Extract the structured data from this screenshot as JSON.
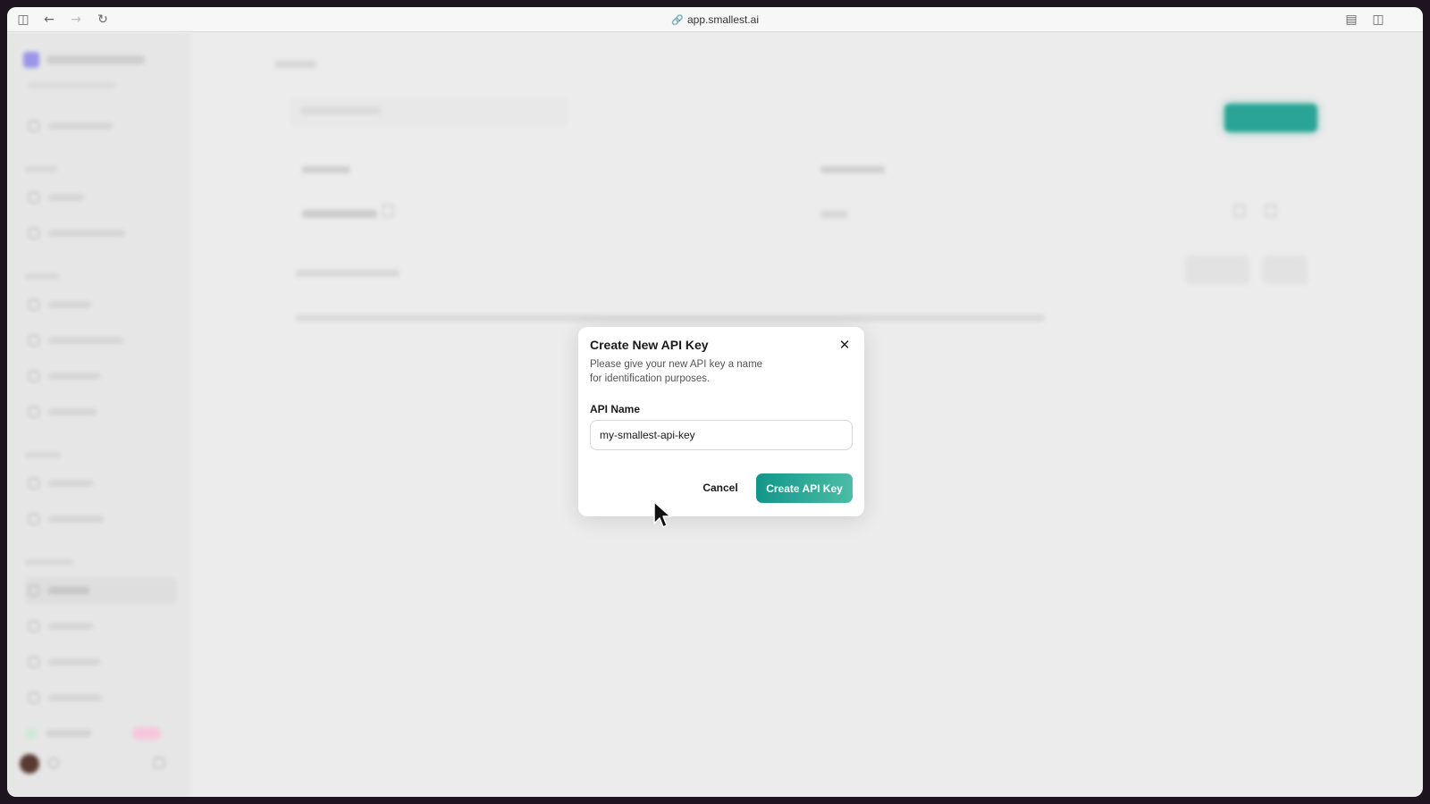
{
  "browser": {
    "url": "app.smallest.ai"
  },
  "modal": {
    "title": "Create New API Key",
    "description": "Please give your new API key a name for identification purposes.",
    "field_label": "API Name",
    "field_value": "my-smallest-api-key",
    "cancel_label": "Cancel",
    "create_label": "Create API Key"
  },
  "icons": {
    "sidebar_toggle": "sidebar-icon",
    "back": "arrow-left-icon",
    "forward": "arrow-right-icon",
    "reload": "reload-icon",
    "link": "link-icon",
    "reader": "reader-icon",
    "split_view": "split-view-icon",
    "close": "close-icon",
    "cursor": "mouse-pointer-icon"
  },
  "colors": {
    "accent_start": "#12968a",
    "accent_end": "#4cbda6"
  }
}
